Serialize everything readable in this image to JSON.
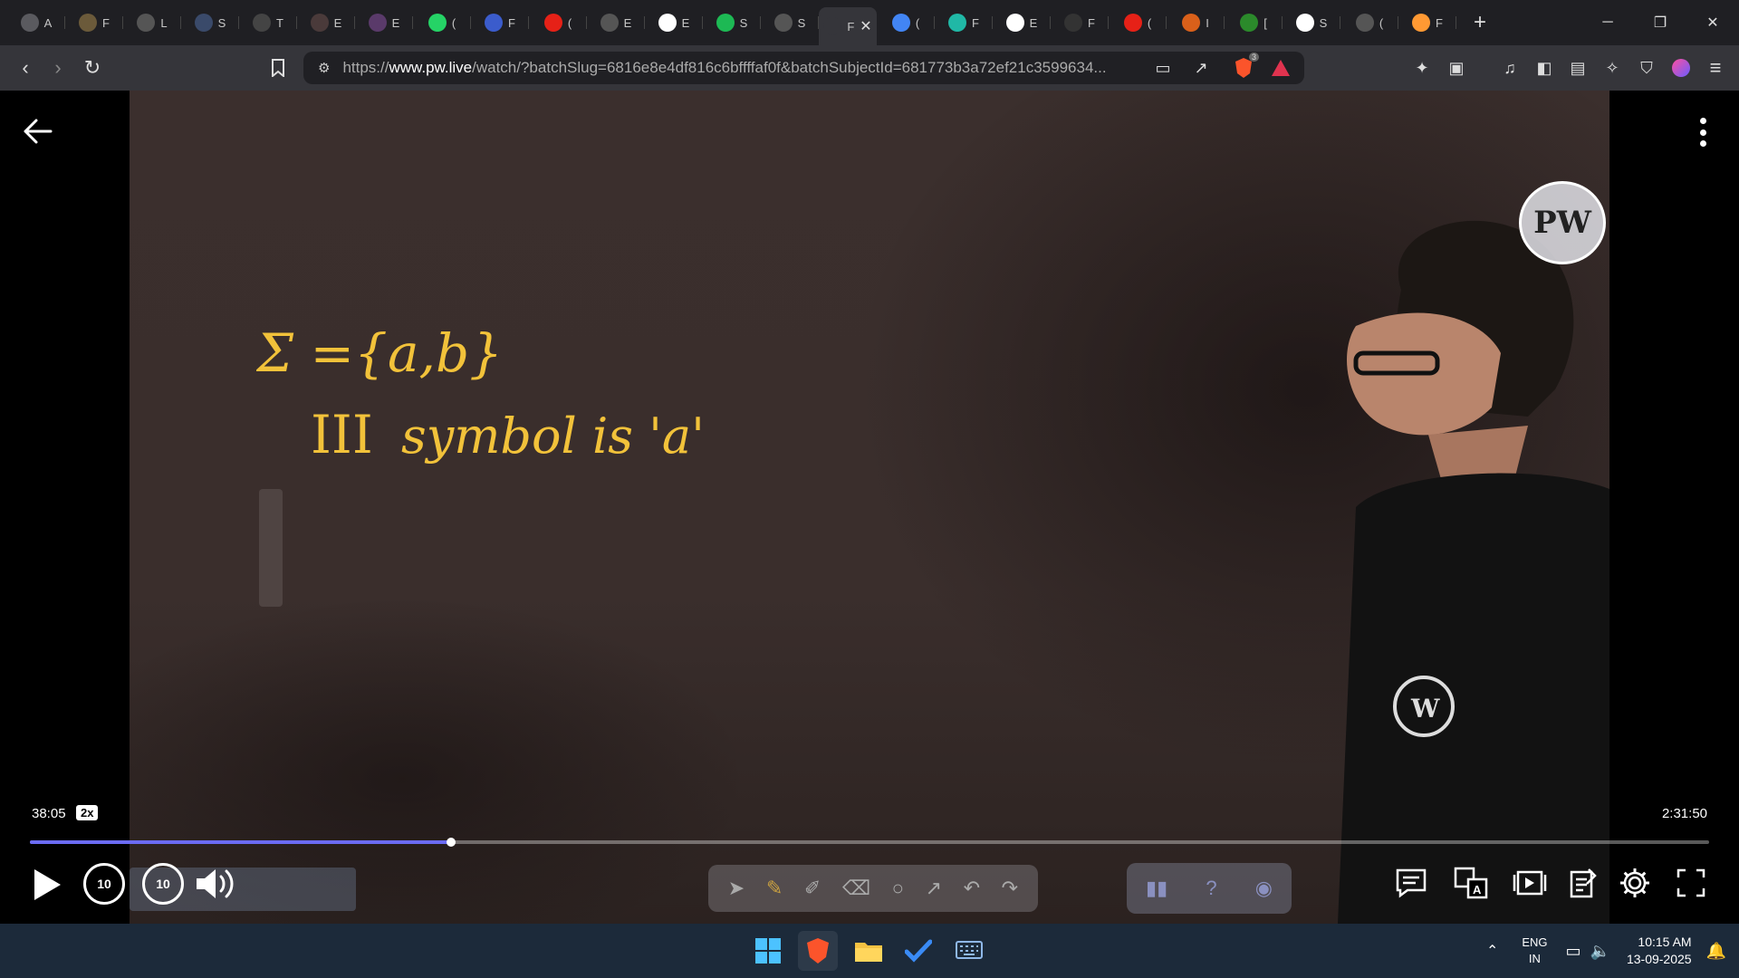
{
  "tabs": [
    {
      "letter": "A",
      "icon": "chatgpt-icon",
      "color": "#5a5a5f"
    },
    {
      "letter": "F",
      "icon": "clock-icon",
      "color": "#6b5a3a"
    },
    {
      "letter": "L",
      "icon": "globe-icon",
      "color": "#555"
    },
    {
      "letter": "S",
      "icon": "site-icon",
      "color": "#3a4a6a"
    },
    {
      "letter": "T",
      "icon": "w3-icon",
      "color": "#444"
    },
    {
      "letter": "E",
      "icon": "site-icon",
      "color": "#4a3a3a"
    },
    {
      "letter": "E",
      "icon": "site-icon",
      "color": "#5a3a6a"
    },
    {
      "letter": "(",
      "icon": "whatsapp-icon",
      "color": "#25d366"
    },
    {
      "letter": "F",
      "icon": "flag-icon",
      "color": "#3b5ccc"
    },
    {
      "letter": "(",
      "icon": "youtube-icon",
      "color": "#e62117"
    },
    {
      "letter": "E",
      "icon": "site-icon",
      "color": "#555"
    },
    {
      "letter": "E",
      "icon": "google-icon",
      "color": "#ffffff"
    },
    {
      "letter": "S",
      "icon": "spotify-icon",
      "color": "#1db954"
    },
    {
      "letter": "S",
      "icon": "globe-icon",
      "color": "#555"
    },
    {
      "letter": "F",
      "icon": "pw-icon",
      "color": "#35353a",
      "active": true
    },
    {
      "letter": "(",
      "icon": "gemini-icon",
      "color": "#4285f4"
    },
    {
      "letter": "F",
      "icon": "perplexity-icon",
      "color": "#20b8a6"
    },
    {
      "letter": "E",
      "icon": "google-icon",
      "color": "#ffffff"
    },
    {
      "letter": "F",
      "icon": "monitor-icon",
      "color": "#333"
    },
    {
      "letter": "(",
      "icon": "youtube-icon",
      "color": "#e62117"
    },
    {
      "letter": "I",
      "icon": "site-icon",
      "color": "#d9601a"
    },
    {
      "letter": "[",
      "icon": "site-icon",
      "color": "#2b8a2b"
    },
    {
      "letter": "S",
      "icon": "wiki-icon",
      "color": "#ffffff"
    },
    {
      "letter": "(",
      "icon": "globe-icon",
      "color": "#555"
    },
    {
      "letter": "F",
      "icon": "india-flag-icon",
      "color": "#ff9933"
    }
  ],
  "active_tab_close": "✕",
  "url": {
    "scheme": "https://",
    "host": "www.pw.live",
    "path": "/watch/?batchSlug=6816e8e4df816c6bffffaf0f&batchSubjectId=681773b3a72ef21c3599634..."
  },
  "brave_badge": "3",
  "board": {
    "line1": "Σ ={a,b}",
    "line2_prefix": "III",
    "line2_text": "symbol is 'a'"
  },
  "logo_text": "PW",
  "player": {
    "current_time": "38:05",
    "speed": "2x",
    "total_time": "2:31:50",
    "progress_fraction": 0.2507,
    "skip_seconds": "10"
  },
  "taskbar": {
    "lang_top": "ENG",
    "lang_bottom": "IN",
    "time": "10:15 AM",
    "date": "13-09-2025"
  }
}
